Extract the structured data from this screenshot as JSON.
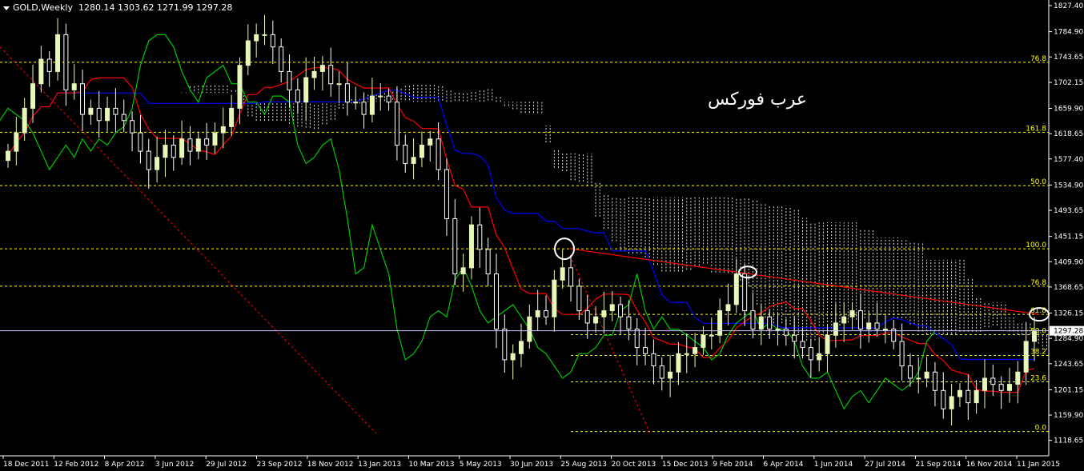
{
  "header": {
    "symbol": "GOLD,Weekly",
    "ohlc": "1280.14 1303.62 1271.99 1297.28"
  },
  "watermark": "عرب فوركس",
  "colors": {
    "background": "#000000",
    "grid": "#ffffff",
    "bull_candle": "#e6f7b8",
    "bear_candle": "#ffffff",
    "tenkan": "#ff0000",
    "kijun": "#0000ff",
    "chikou": "#00c800",
    "cloud": "#ffffff",
    "fib": "#ffff00",
    "trendline": "#ff0000",
    "price_line": "#c8c8ff",
    "axis_text": "#ffffff"
  },
  "chart_data": {
    "type": "candlestick",
    "title": "GOLD,Weekly",
    "ylim": [
      1100,
      1830
    ],
    "y_ticks": [
      "1827.40",
      "1784.90",
      "1743.65",
      "1702.15",
      "1659.90",
      "1618.65",
      "1577.40",
      "1534.90",
      "1493.65",
      "1451.15",
      "1409.90",
      "1368.65",
      "1326.15",
      "1284.90",
      "1243.65",
      "1201.15",
      "1159.90",
      "1118.65"
    ],
    "x_ticks": [
      "18 Dec 2011",
      "12 Feb 2012",
      "8 Apr 2012",
      "3 Jun 2012",
      "29 Jul 2012",
      "23 Sep 2012",
      "18 Nov 2012",
      "13 Jan 2013",
      "10 Mar 2013",
      "5 May 2013",
      "30 Jun 2013",
      "25 Aug 2013",
      "20 Oct 2013",
      "15 Dec 2013",
      "9 Feb 2014",
      "6 Apr 2014",
      "1 Jun 2014",
      "27 Jul 2014",
      "21 Sep 2014",
      "16 Nov 2014",
      "11 Jan 2015"
    ],
    "current_price": "1297.28",
    "current_value": 1297.28,
    "fib_levels_left": [
      {
        "label": "76.8",
        "value": 1735
      },
      {
        "label": "161.8",
        "value": 1621
      },
      {
        "label": "50.0",
        "value": 1534
      },
      {
        "label": "100.0",
        "value": 1431
      },
      {
        "label": "76.8",
        "value": 1370
      }
    ],
    "fib_levels_right": [
      {
        "label": "61.8",
        "value": 1324
      },
      {
        "label": "50.0",
        "value": 1291
      },
      {
        "label": "38.2",
        "value": 1257
      },
      {
        "label": "23.6",
        "value": 1214
      },
      {
        "label": "0.0",
        "value": 1133
      }
    ],
    "close": [
      1590,
      1620,
      1660,
      1700,
      1740,
      1720,
      1780,
      1690,
      1700,
      1650,
      1660,
      1640,
      1660,
      1650,
      1640,
      1620,
      1590,
      1560,
      1580,
      1600,
      1580,
      1610,
      1590,
      1610,
      1600,
      1620,
      1630,
      1660,
      1730,
      1770,
      1780,
      1780,
      1760,
      1720,
      1690,
      1670,
      1710,
      1720,
      1730,
      1700,
      1700,
      1670,
      1670,
      1650,
      1680,
      1680,
      1670,
      1600,
      1570,
      1580,
      1600,
      1610,
      1560,
      1480,
      1390,
      1400,
      1470,
      1430,
      1390,
      1300,
      1250,
      1260,
      1280,
      1320,
      1330,
      1320,
      1380,
      1400,
      1370,
      1330,
      1310,
      1320,
      1330,
      1340,
      1320,
      1300,
      1270,
      1260,
      1240,
      1220,
      1230,
      1260,
      1260,
      1270,
      1290,
      1290,
      1330,
      1340,
      1390,
      1330,
      1300,
      1320,
      1300,
      1300,
      1290,
      1280,
      1270,
      1250,
      1260,
      1290,
      1310,
      1320,
      1330,
      1300,
      1310,
      1300,
      1300,
      1280,
      1240,
      1220,
      1220,
      1230,
      1200,
      1170,
      1190,
      1200,
      1180,
      1200,
      1220,
      1210,
      1200,
      1210,
      1230,
      1280,
      1297
    ]
  }
}
